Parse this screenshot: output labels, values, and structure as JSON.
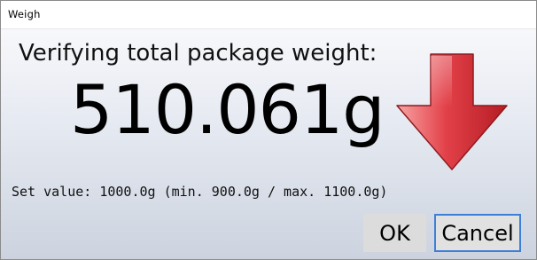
{
  "window": {
    "title": "Weigh"
  },
  "dialog": {
    "heading": "Verifying total package weight:",
    "reading": "510.061g",
    "set_value_text": "Set value: 1000.0g (min. 900.0g / max. 1100.0g)",
    "indicator_icon": "red-down-arrow",
    "indicator_color": "#d9343a"
  },
  "buttons": {
    "ok_label": "OK",
    "cancel_label": "Cancel"
  }
}
